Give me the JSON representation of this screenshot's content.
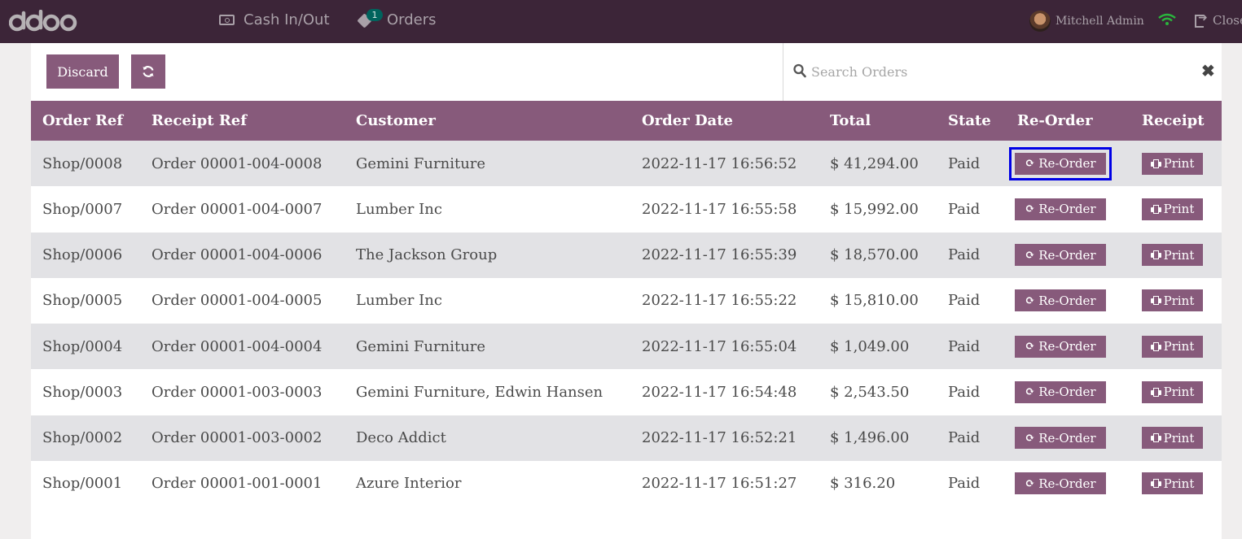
{
  "topbar": {
    "cash_label": "Cash In/Out",
    "orders_label": "Orders",
    "orders_badge": "1",
    "user_name": "Mitchell Admin",
    "close_label": "Close"
  },
  "controls": {
    "discard_label": "Discard",
    "search_placeholder": "Search Orders"
  },
  "table": {
    "headers": [
      "Order Ref",
      "Receipt Ref",
      "Customer",
      "Order Date",
      "Total",
      "State",
      "Re-Order",
      "Receipt"
    ],
    "reorder_label": "Re-Order",
    "print_label": "Print",
    "rows": [
      {
        "ref": "Shop/0008",
        "receipt": "Order 00001-004-0008",
        "customer": "Gemini Furniture",
        "date": "2022-11-17 16:56:52",
        "total": "$ 41,294.00",
        "state": "Paid"
      },
      {
        "ref": "Shop/0007",
        "receipt": "Order 00001-004-0007",
        "customer": "Lumber Inc",
        "date": "2022-11-17 16:55:58",
        "total": "$ 15,992.00",
        "state": "Paid"
      },
      {
        "ref": "Shop/0006",
        "receipt": "Order 00001-004-0006",
        "customer": "The Jackson Group",
        "date": "2022-11-17 16:55:39",
        "total": "$ 18,570.00",
        "state": "Paid"
      },
      {
        "ref": "Shop/0005",
        "receipt": "Order 00001-004-0005",
        "customer": "Lumber Inc",
        "date": "2022-11-17 16:55:22",
        "total": "$ 15,810.00",
        "state": "Paid"
      },
      {
        "ref": "Shop/0004",
        "receipt": "Order 00001-004-0004",
        "customer": "Gemini Furniture",
        "date": "2022-11-17 16:55:04",
        "total": "$ 1,049.00",
        "state": "Paid"
      },
      {
        "ref": "Shop/0003",
        "receipt": "Order 00001-003-0003",
        "customer": "Gemini Furniture, Edwin Hansen",
        "date": "2022-11-17 16:54:48",
        "total": "$ 2,543.50",
        "state": "Paid"
      },
      {
        "ref": "Shop/0002",
        "receipt": "Order 00001-003-0002",
        "customer": "Deco Addict",
        "date": "2022-11-17 16:52:21",
        "total": "$ 1,496.00",
        "state": "Paid"
      },
      {
        "ref": "Shop/0001",
        "receipt": "Order 00001-001-0001",
        "customer": "Azure Interior",
        "date": "2022-11-17 16:51:27",
        "total": "$ 316.20",
        "state": "Paid"
      }
    ]
  },
  "colors": {
    "topbar_bg": "#3c2538",
    "accent": "#875a7b",
    "highlight_outline": "#0000e6",
    "badge_bg": "#00635d",
    "wifi": "#2ab53d"
  }
}
